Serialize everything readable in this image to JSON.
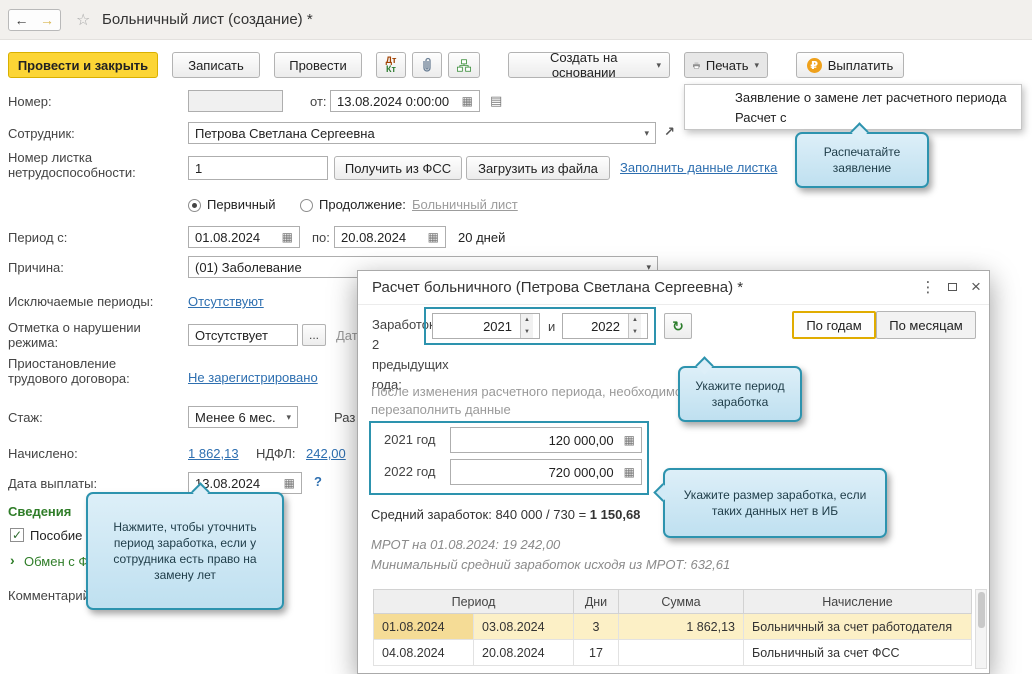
{
  "icons": {
    "back": "←",
    "forward": "→",
    "star": "☆",
    "combo": "▾",
    "calendar": "▦",
    "list": "▤",
    "open": "↗",
    "ellipsis": "...",
    "help": "?",
    "spin_up": "▲",
    "spin_down": "▼",
    "refresh": "↻",
    "more": "⋮",
    "close": "×",
    "expander": "›",
    "check": "✓",
    "ruble": "₽",
    "dt": "Дт",
    "kt": "Кт"
  },
  "window": {
    "title": "Больничный лист (создание) *"
  },
  "toolbar": {
    "post_and_close": "Провести и закрыть",
    "write": "Записать",
    "post": "Провести",
    "create_based_on": "Создать на основании",
    "print": "Печать",
    "pay": "Выплатить"
  },
  "print_menu": {
    "items": [
      "Заявление о замене лет расчетного периода",
      "Расчет с"
    ]
  },
  "form": {
    "number_label": "Номер:",
    "number_value": "",
    "from_label": "от:",
    "doc_date": "13.08.2024 0:00:00",
    "employee_label": "Сотрудник:",
    "employee_value": "Петрова Светлана Сергеевна",
    "sick_list_label_1": "Номер листка",
    "sick_list_label_2": "нетрудоспособности:",
    "sick_list_number": "1",
    "get_from_fss": "Получить из ФСС",
    "load_from_file": "Загрузить из файла",
    "fill_sheet_link": "Заполнить данные листка",
    "primary_radio": "Первичный",
    "continuation_radio": "Продолжение:",
    "continuation_link": "Больничный лист",
    "period_label": "Период с:",
    "period_from": "01.08.2024",
    "period_to_label": "по:",
    "period_to": "20.08.2024",
    "period_days": "20 дней",
    "reason_label": "Причина:",
    "reason_value": "(01) Заболевание",
    "excluded_label": "Исключаемые периоды:",
    "excluded_value": "Отсутствуют",
    "violation_label_1": "Отметка о нарушении",
    "violation_label_2": "режима:",
    "violation_value": "Отсутствует",
    "violation_date_label": "Дата",
    "suspension_label_1": "Приостановление",
    "suspension_label_2": "трудового договора:",
    "suspension_value": "Не зарегистрировано",
    "seniority_label": "Стаж:",
    "seniority_value": "Менее 6 мес.",
    "seniority_extra": "Раз",
    "accrued_label": "Начислено:",
    "accrued_value": "1 862,13",
    "ndfl_label": "НДФЛ:",
    "ndfl_value": "242,00",
    "pay_date_label": "Дата выплаты:",
    "pay_date_value": "13.08.2024",
    "info_section": "Сведения",
    "benefit_label": "Пособие",
    "exchange_label": "Обмен с ФСС",
    "comment_label": "Комментарий:"
  },
  "callouts": {
    "print_hint": "Распечатайте заявление",
    "earnings_link_hint": "Нажмите, чтобы уточнить период заработка, если у сотрудника есть право на замену лет",
    "period_hint": "Укажите период заработка",
    "amount_hint": "Укажите размер заработка, если таких данных нет в ИБ"
  },
  "dialog": {
    "title": "Расчет больничного (Петрова Светлана Сергеевна) *",
    "earnings_label": "Заработок за 2 предыдущих года:",
    "year_from": "2021",
    "and_label": "и",
    "year_to": "2022",
    "by_years": "По годам",
    "by_months": "По месяцам",
    "refill_note": "После изменения расчетного периода, необходимо перезаполнить данные",
    "earnings_rows": [
      {
        "label": "2021 год",
        "value": "120 000,00"
      },
      {
        "label": "2022 год",
        "value": "720 000,00"
      }
    ],
    "average_prefix": "Средний заработок: 840 000 / 730 = ",
    "average_value": "1 150,68",
    "mrot_line_1": "МРОТ на 01.08.2024: 19 242,00",
    "mrot_line_2": "Минимальный средний заработок исходя из МРОТ: 632,61",
    "table": {
      "period_header": "Период",
      "days_header": "Дни",
      "sum_header": "Сумма",
      "accrual_header": "Начисление",
      "rows": [
        {
          "from": "01.08.2024",
          "to": "03.08.2024",
          "days": "3",
          "sum": "1 862,13",
          "accrual": "Больничный за счет работодателя"
        },
        {
          "from": "04.08.2024",
          "to": "20.08.2024",
          "days": "17",
          "sum": "",
          "accrual": "Больничный за счет ФСС"
        }
      ]
    }
  }
}
